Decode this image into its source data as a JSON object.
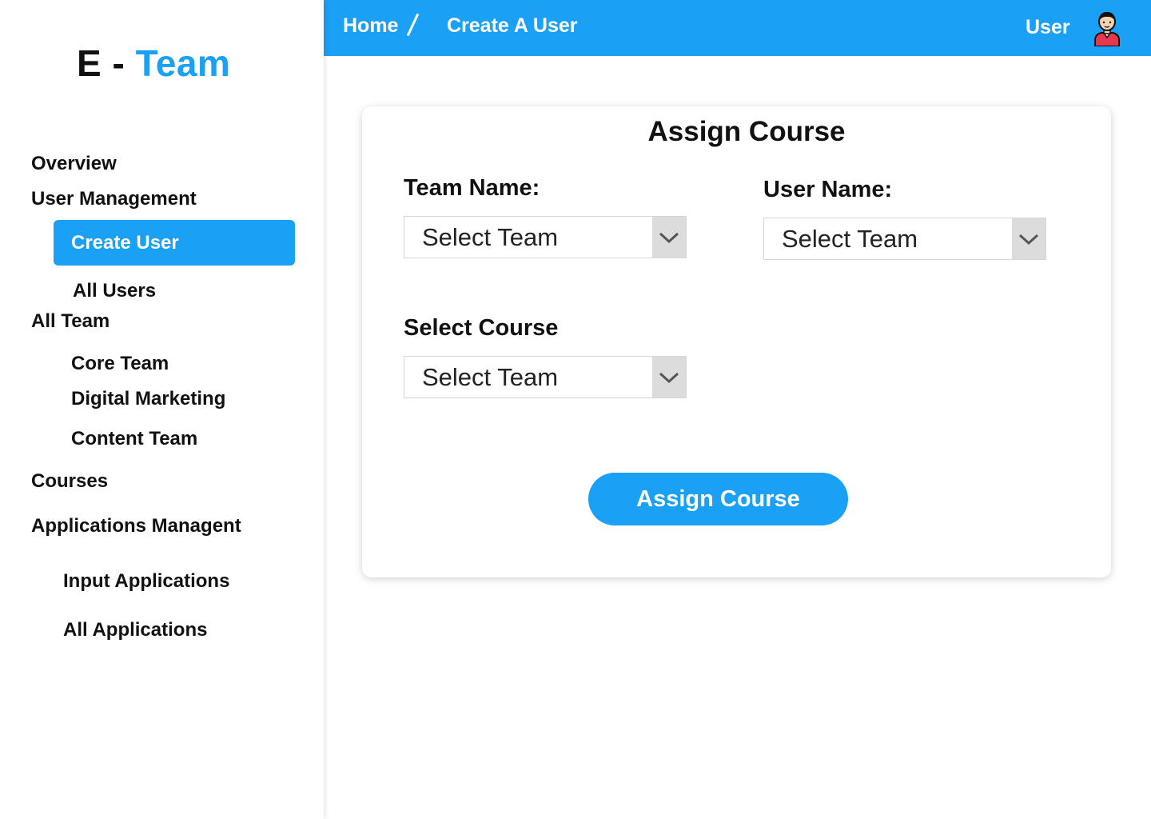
{
  "logo": {
    "first": "E",
    "separator": "-",
    "second": "Team"
  },
  "sidebar": {
    "items": [
      {
        "label": "Overview"
      },
      {
        "label": "User Management"
      },
      {
        "label": "Create User",
        "active": true
      },
      {
        "label": "All Users"
      },
      {
        "label": "All Team"
      },
      {
        "label": "Core Team"
      },
      {
        "label": "Digital Marketing"
      },
      {
        "label": "Content Team"
      },
      {
        "label": "Courses"
      },
      {
        "label": "Applications Managent"
      },
      {
        "label": "Input Applications"
      },
      {
        "label": "All Applications"
      }
    ]
  },
  "header": {
    "breadcrumb": [
      {
        "label": "Home"
      },
      {
        "label": "Create A User"
      }
    ],
    "user_label": "User",
    "avatar_icon": "user-avatar-icon"
  },
  "card": {
    "title": "Assign Course",
    "team_name": {
      "label": "Team Name:",
      "value": "Select Team"
    },
    "user_name": {
      "label": "User Name:",
      "value": "Select Team"
    },
    "course": {
      "label": "Select Course",
      "value": "Select Team"
    },
    "submit_label": "Assign Course"
  },
  "colors": {
    "accent": "#1aa0f5",
    "arrow_bg": "#dcdcdc"
  }
}
